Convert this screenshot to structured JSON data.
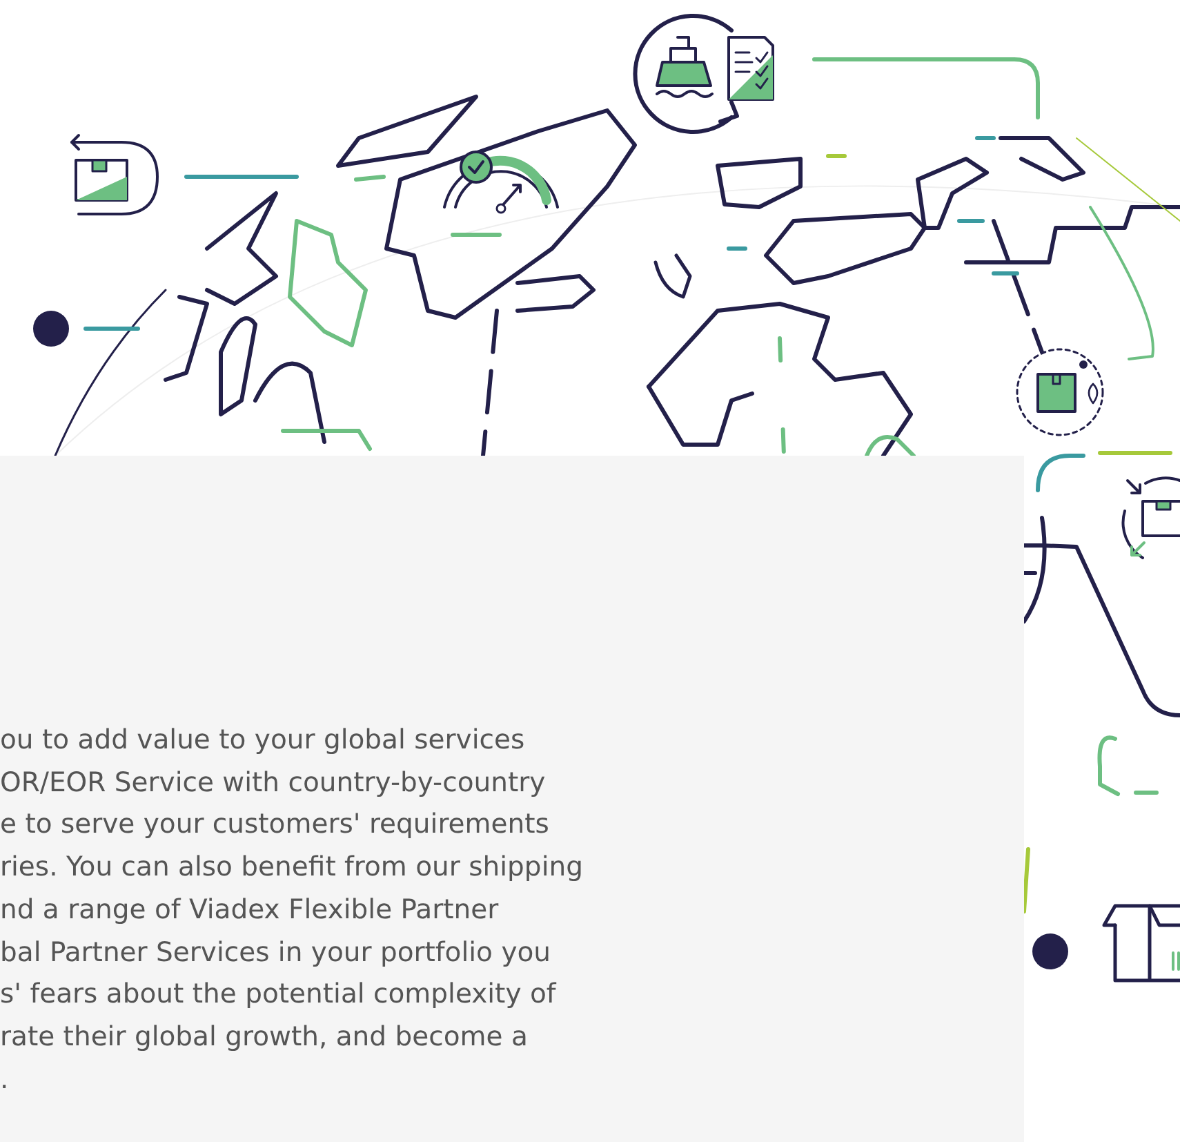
{
  "intro": {
    "lines": [
      "ou to add value to your global services",
      "OR/EOR Service with country-by-country",
      "e to serve your customers' requirements",
      "ries. You can also benefit from our shipping",
      "nd a range of Viadex Flexible Partner",
      "bal Partner Services in your portfolio you",
      "s' fears about the potential complexity of",
      "rate their global growth, and become a",
      "."
    ]
  }
}
